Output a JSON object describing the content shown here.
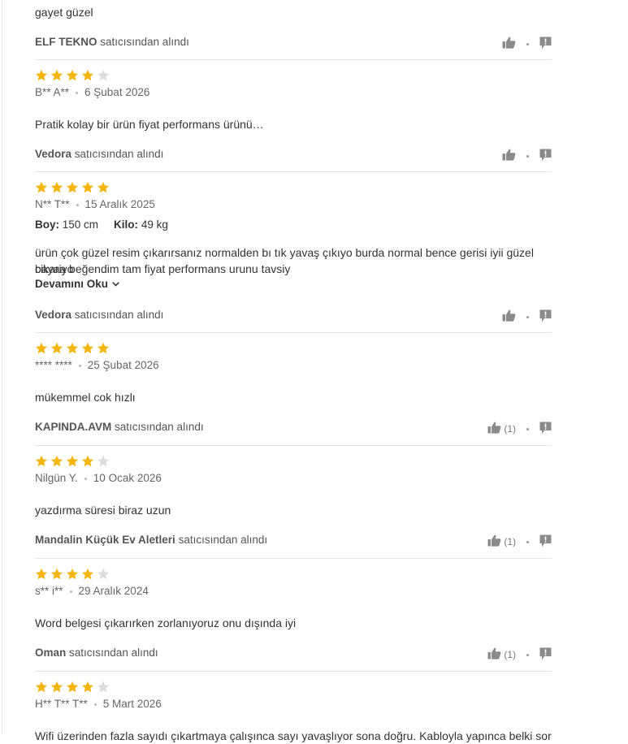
{
  "seller_suffix": "satıcısından alındı",
  "colors": {
    "star": "#f5b50f",
    "star_empty": "#dcdcdc",
    "icon": "#8a8a8a"
  },
  "top_comment": "gayet güzel",
  "first_seller": "ELF TEKNO",
  "reviews": [
    {
      "rating": 4,
      "author": "B** A**",
      "date": "6 Şubat 2026",
      "comment": "Pratik kolay bir ürün fiyat performans ürünü…",
      "seller": "Vedora",
      "likes": ""
    },
    {
      "rating": 5,
      "author": "N** T**",
      "date": "15 Aralık 2025",
      "height_label": "Boy:",
      "height_value": "150 cm",
      "weight_label": "Kilo:",
      "weight_value": "49 kg",
      "comment_line1": "ürün çok güzel resim çıkarırsanız normalden bı tık yavaş çıkıyo burda normal bence gerisi iyii güzel cikariyo",
      "comment_line2": "bayaa beğendim tam fiyat performans urunu tavsiy",
      "read_more": "Devamını Oku",
      "seller": "Vedora",
      "likes": ""
    },
    {
      "rating": 5,
      "author": "**** ****",
      "date": "25 Şubat 2026",
      "comment": "mükemmel cok hızlı",
      "seller": "KAPINDA.AVM",
      "likes": "(1)"
    },
    {
      "rating": 4,
      "author": "Nilgün Y.",
      "date": "10 Ocak 2026",
      "comment": "yazdırma süresi biraz uzun",
      "seller": "Mandalin Küçük Ev Aletleri",
      "likes": "(1)"
    },
    {
      "rating": 4,
      "author": "s** i**",
      "date": "29 Aralık 2024",
      "comment": "Word belgesi çıkarırken zorlanıyoruz onu dışında iyi",
      "seller": "Oman",
      "likes": "(1)"
    },
    {
      "rating": 4,
      "author": "H** T** T**",
      "date": "5 Mart 2026",
      "comment": "Wifi üzerinden fazla sayıdı çıkartmaya çalışınca sayı yavaşlıyor sona doğru. Kabloyla yapınca belki sorun"
    }
  ]
}
